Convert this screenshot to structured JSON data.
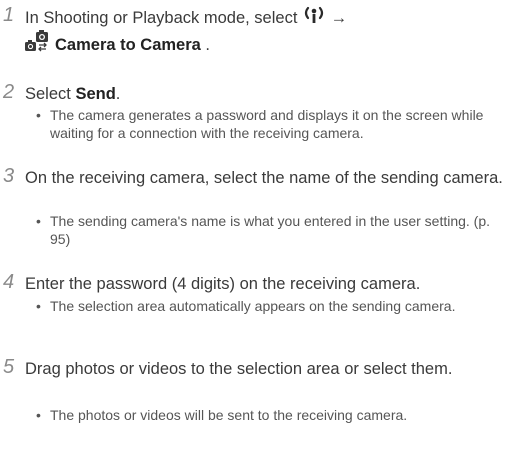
{
  "steps": [
    {
      "number": "1",
      "text_before": "In Shooting or Playback mode, select",
      "arrow": "→",
      "option_label": "Camera to Camera",
      "text_after": " .",
      "icons": [
        "wifi-share-icon",
        "camera-to-camera-icon"
      ]
    },
    {
      "number": "2",
      "text_before": "Select ",
      "bold": "Send",
      "text_after": ".",
      "bullet": "The camera generates a password and displays it on the screen while waiting for a connection with the receiving camera."
    },
    {
      "number": "3",
      "text": "On the receiving camera, select the name of the sending camera.",
      "bullet": "The sending camera's name is what you entered in the user setting. (p. 95)"
    },
    {
      "number": "4",
      "text": "Enter the password (4 digits) on the receiving camera.",
      "bullet": "The selection area automatically appears on the sending camera."
    },
    {
      "number": "5",
      "text": "Drag photos or videos to the selection area or select them.",
      "bullet": "The photos or videos will be sent to the receiving camera."
    }
  ],
  "bullet_symbol": "•",
  "colors": {
    "text": "#3a3a3a",
    "step_number": "#8a8a8a",
    "bullet_text": "#555555"
  }
}
